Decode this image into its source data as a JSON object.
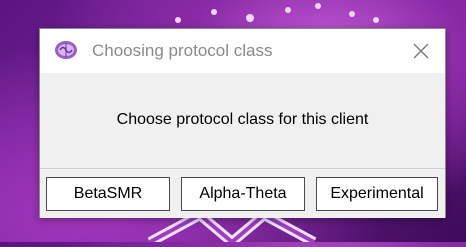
{
  "dialog": {
    "title": "Choosing protocol class",
    "message": "Choose protocol class for this client",
    "buttons": {
      "beta": "BetaSMR",
      "alpha": "Alpha-Theta",
      "experimental": "Experimental"
    },
    "icons": {
      "app": "brain-app-icon",
      "close": "close-icon"
    }
  },
  "colors": {
    "desktop_accent": "#8a2aa6",
    "title_text": "#8a8a8a",
    "dialog_bg": "#f0f0f0"
  }
}
